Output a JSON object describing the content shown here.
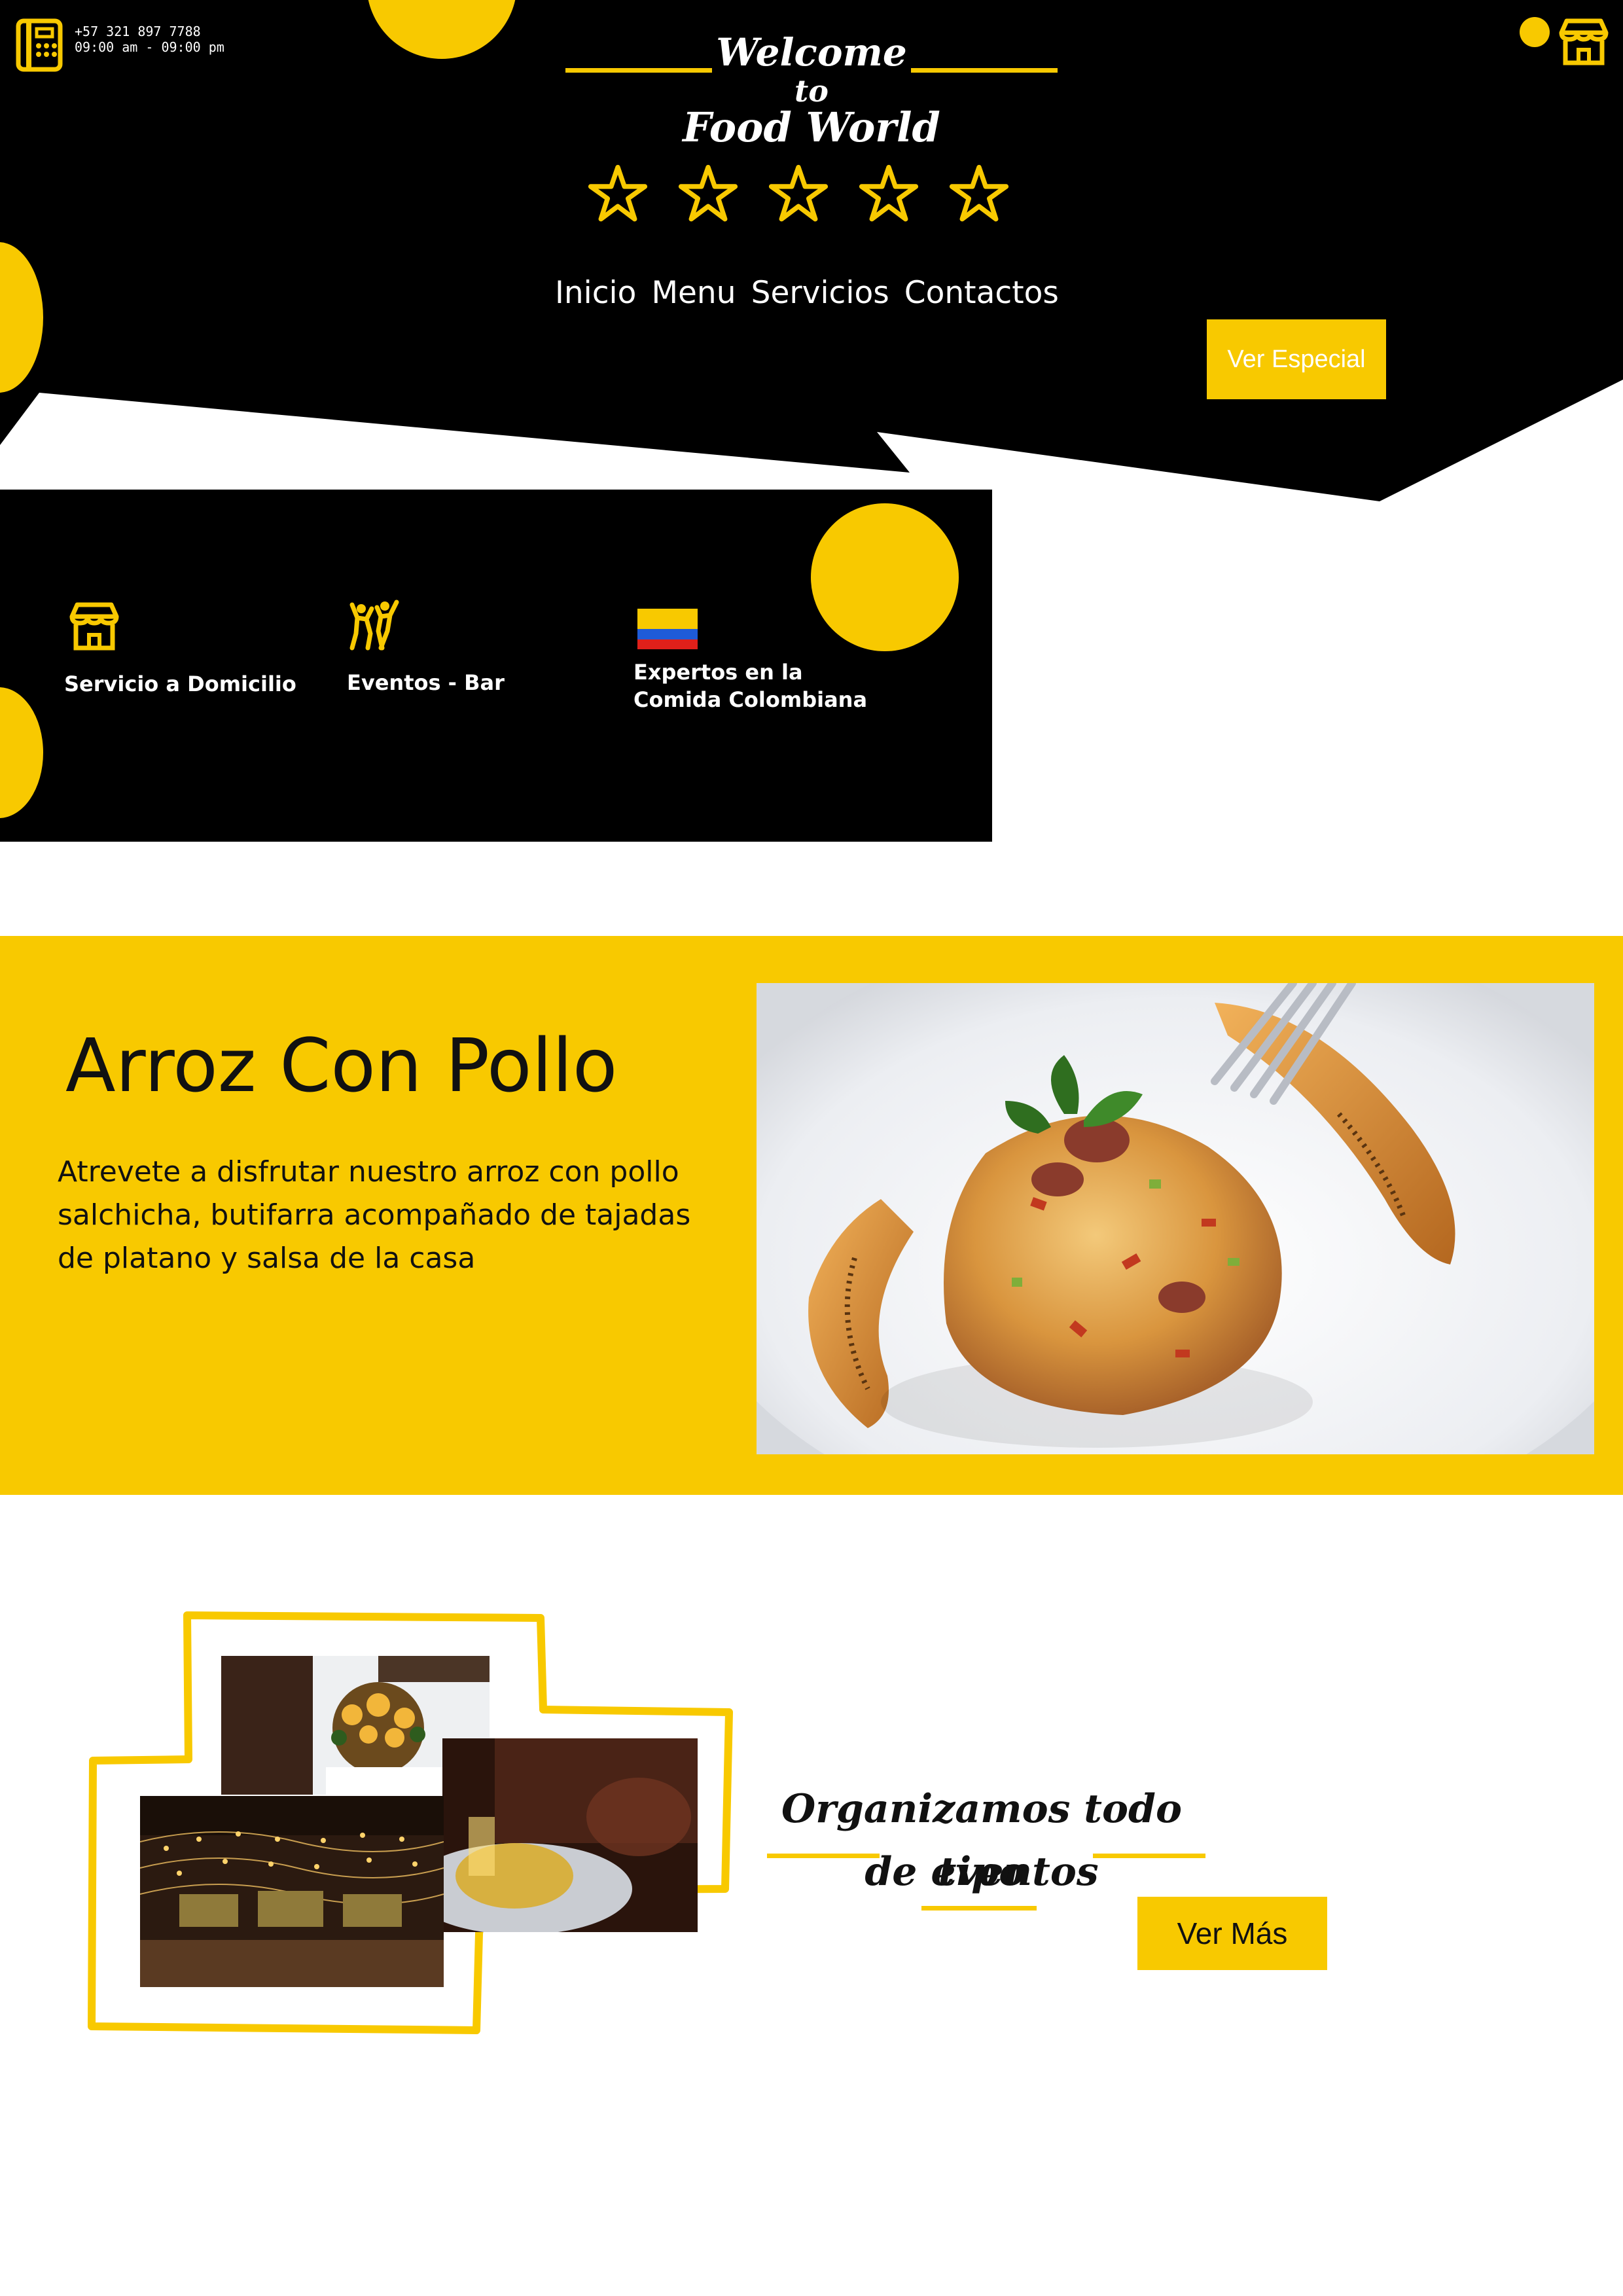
{
  "header": {
    "phone": "+57 321 897 7788",
    "hours": "09:00 am - 09:00 pm",
    "welcome": [
      "Welcome",
      "to",
      "Food World"
    ],
    "rating_stars": 5,
    "nav": [
      "Inicio",
      "Menu",
      "Servicios",
      "Contactos"
    ],
    "special_button": "Ver Especial"
  },
  "features": [
    {
      "icon": "store-icon",
      "label": "Servicio a Domicilio"
    },
    {
      "icon": "dancing-people-icon",
      "label": "Eventos - Bar"
    },
    {
      "icon": "colombia-flag-icon",
      "label": "Expertos en la\nComida Colombiana"
    }
  ],
  "dish": {
    "title": "Arroz Con Pollo",
    "description": "Atrevete a disfrutar nuestro arroz con pollo\n salchicha, butifarra acompañado de tajadas\nde platano y salsa de la casa"
  },
  "events": {
    "title_line1": "Organizamos todo tipo",
    "title_line2": "de eventos",
    "button": "Ver Más"
  },
  "colors": {
    "accent": "#f8c900",
    "dark": "#000000",
    "light": "#ffffff"
  }
}
